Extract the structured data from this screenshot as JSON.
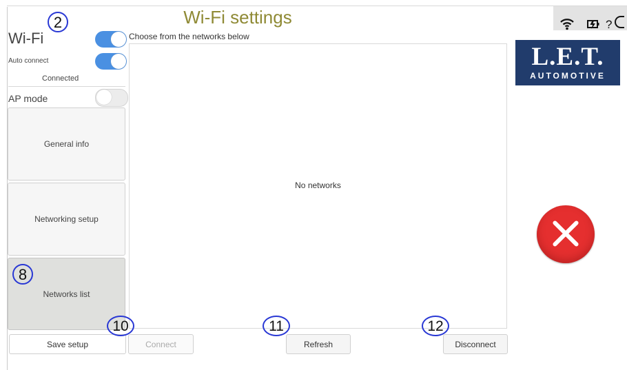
{
  "title": "Wi-Fi settings",
  "status_icons": [
    "wifi-icon",
    "battery-charging-icon",
    "question-icon"
  ],
  "status_text": "?",
  "logo": {
    "main": "L.E.T.",
    "sub": "AUTOMOTIVE"
  },
  "left": {
    "wifi_label": "Wi-Fi",
    "auto_connect_label": "Auto connect",
    "connection_status": "Connected",
    "ap_mode_label": "AP mode",
    "cards": [
      {
        "label": "General info"
      },
      {
        "label": "Networking setup"
      },
      {
        "label": "Networks list"
      }
    ],
    "save_label": "Save setup"
  },
  "networks": {
    "instruction": "Choose from the networks below",
    "empty_message": "No networks"
  },
  "buttons": {
    "connect": "Connect",
    "refresh": "Refresh",
    "disconnect": "Disconnect"
  },
  "badges": [
    "2",
    "8",
    "10",
    "11",
    "12"
  ],
  "colors": {
    "title": "#8f8a35",
    "toggle_on": "#4a90e2",
    "logo_background": "#213c6c",
    "error": "#e52f2f",
    "badge_outline": "#2837d4"
  }
}
